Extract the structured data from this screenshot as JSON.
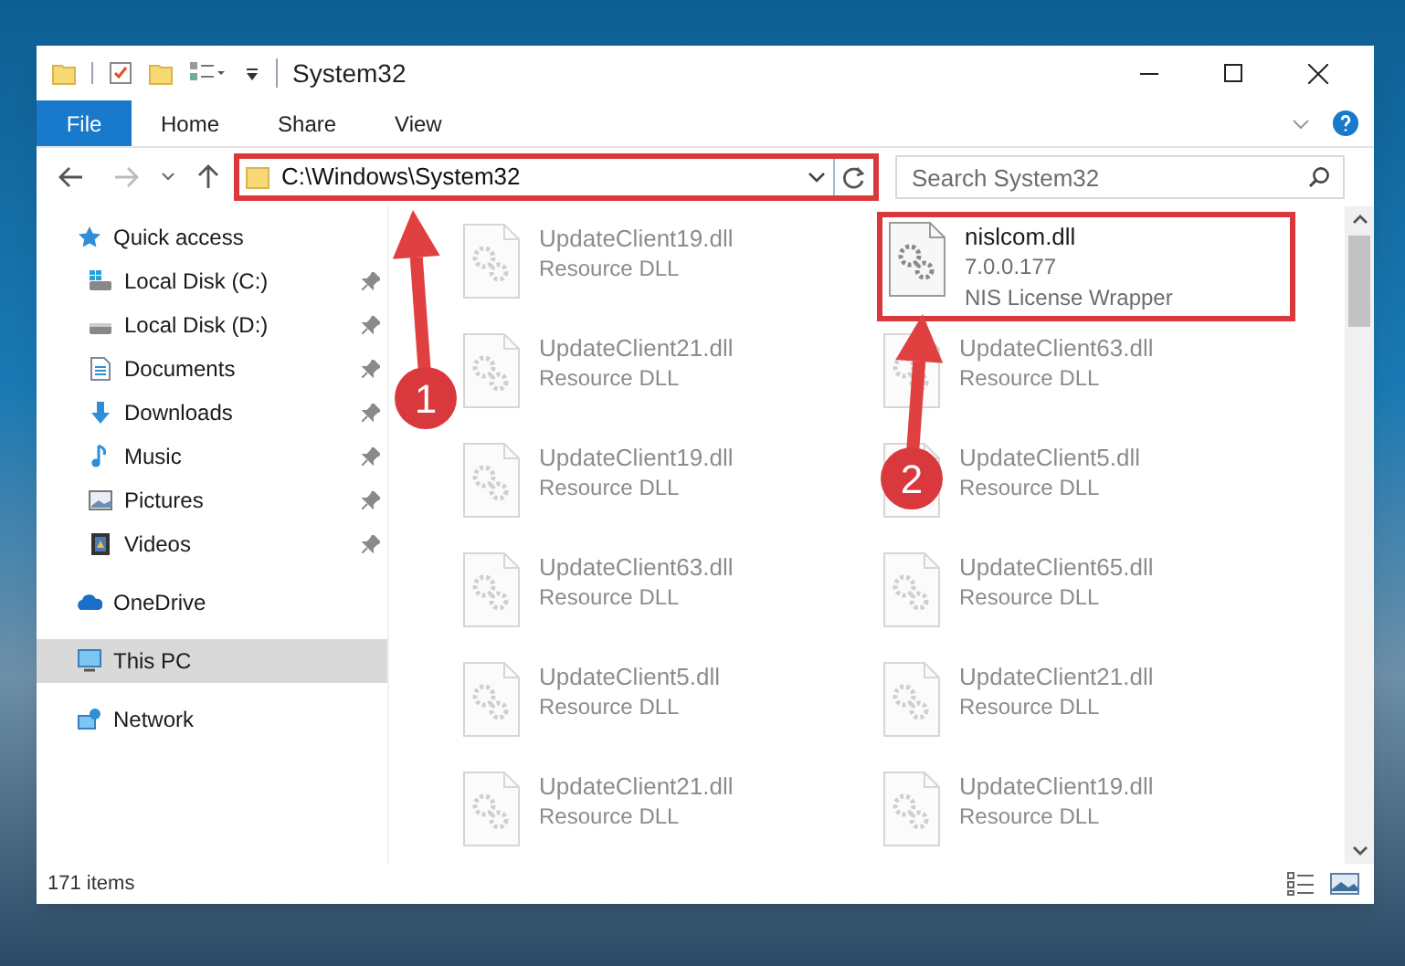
{
  "window": {
    "title": "System32"
  },
  "ribbon_tabs": [
    {
      "label": "File",
      "selected": true
    },
    {
      "label": "Home",
      "selected": false
    },
    {
      "label": "Share",
      "selected": false
    },
    {
      "label": "View",
      "selected": false
    }
  ],
  "address_bar": {
    "value": "C:\\Windows\\System32",
    "highlighted": true
  },
  "search": {
    "placeholder": "Search System32"
  },
  "sidebar": {
    "items": [
      {
        "label": "Quick access",
        "selected": false,
        "children": [
          {
            "label": "Local Disk (C:)",
            "pinned": true
          },
          {
            "label": "Local Disk (D:)",
            "pinned": true
          },
          {
            "label": "Documents",
            "pinned": true
          },
          {
            "label": "Downloads",
            "pinned": true
          },
          {
            "label": "Music",
            "pinned": true
          },
          {
            "label": "Pictures",
            "pinned": true
          },
          {
            "label": "Videos",
            "pinned": true
          }
        ]
      },
      {
        "label": "OneDrive",
        "selected": false
      },
      {
        "label": "This PC",
        "selected": true
      },
      {
        "label": "Network",
        "selected": false
      }
    ]
  },
  "files": [
    {
      "name": "UpdateClient19.dll",
      "description": "Resource DLL",
      "dimmed": true,
      "highlighted": false
    },
    {
      "name": "nislcom.dll",
      "version": "7.0.0.177",
      "description": "NIS License Wrapper",
      "dimmed": false,
      "highlighted": true
    },
    {
      "name": "UpdateClient21.dll",
      "description": "Resource DLL",
      "dimmed": true,
      "highlighted": false
    },
    {
      "name": "UpdateClient63.dll",
      "description": "Resource DLL",
      "dimmed": true,
      "highlighted": false
    },
    {
      "name": "UpdateClient19.dll",
      "description": "Resource DLL",
      "dimmed": true,
      "highlighted": false
    },
    {
      "name": "UpdateClient5.dll",
      "description": "Resource DLL",
      "dimmed": true,
      "highlighted": false
    },
    {
      "name": "UpdateClient63.dll",
      "description": "Resource DLL",
      "dimmed": true,
      "highlighted": false
    },
    {
      "name": "UpdateClient65.dll",
      "description": "Resource DLL",
      "dimmed": true,
      "highlighted": false
    },
    {
      "name": "UpdateClient5.dll",
      "description": "Resource DLL",
      "dimmed": true,
      "highlighted": false
    },
    {
      "name": "UpdateClient21.dll",
      "description": "Resource DLL",
      "dimmed": true,
      "highlighted": false
    },
    {
      "name": "UpdateClient21.dll",
      "description": "Resource DLL",
      "dimmed": true,
      "highlighted": false
    },
    {
      "name": "UpdateClient19.dll",
      "description": "Resource DLL",
      "dimmed": true,
      "highlighted": false
    }
  ],
  "status_bar": {
    "item_count": "171 items"
  },
  "annotations": [
    {
      "number": "1"
    },
    {
      "number": "2"
    }
  ]
}
